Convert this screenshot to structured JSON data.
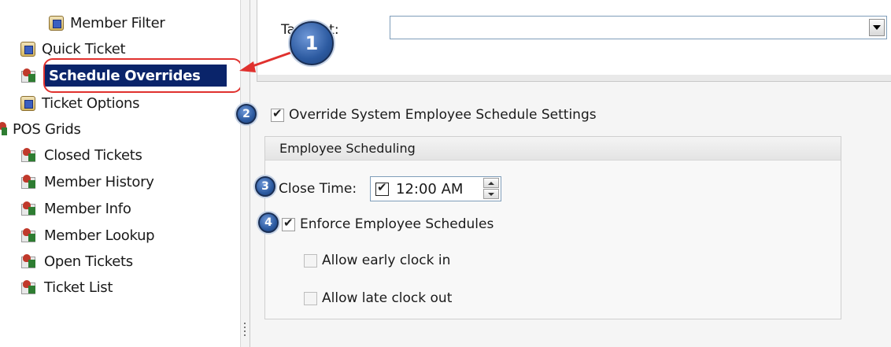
{
  "tree": {
    "items": [
      {
        "label": "Member Filter",
        "icon": "form-icon"
      },
      {
        "label": "Quick Ticket",
        "icon": "form-icon"
      },
      {
        "label": "Schedule Overrides",
        "icon": "grid-icon"
      },
      {
        "label": "Ticket Options",
        "icon": "form-icon"
      },
      {
        "label": "POS Grids",
        "icon": "grid-icon"
      },
      {
        "label": "Closed Tickets",
        "icon": "grid-icon"
      },
      {
        "label": "Member History",
        "icon": "grid-icon"
      },
      {
        "label": "Member Info",
        "icon": "grid-icon"
      },
      {
        "label": "Member Lookup",
        "icon": "grid-icon"
      },
      {
        "label": "Open Tickets",
        "icon": "grid-icon"
      },
      {
        "label": "Ticket List",
        "icon": "grid-icon"
      }
    ],
    "selected": "Schedule Overrides"
  },
  "form": {
    "tg_label": "Ta   ment:",
    "tg_value": "",
    "override_label": "Override System Employee Schedule Settings",
    "override_checked": true,
    "group_title": "Employee Scheduling",
    "close_time_label": "Close Time:",
    "close_time_value": "12:00 AM",
    "close_time_enabled": true,
    "enforce_label": "Enforce Employee Schedules",
    "enforce_checked": true,
    "early_label": "Allow early clock in",
    "early_checked": false,
    "late_label": "Allow late clock out",
    "late_checked": false
  },
  "callouts": [
    "1",
    "2",
    "3",
    "4"
  ],
  "colors": {
    "selection": "#0a246a",
    "callout": "#2c5aa0",
    "highlight": "#e0312e"
  }
}
